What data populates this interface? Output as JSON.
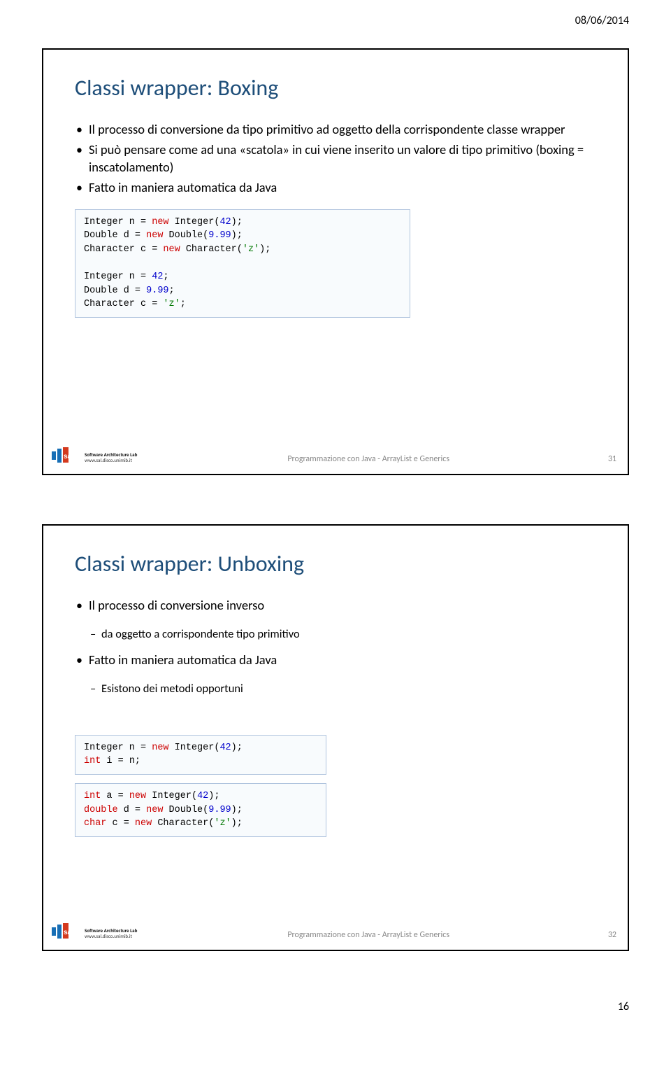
{
  "page": {
    "date": "08/06/2014",
    "number": "16"
  },
  "slide1": {
    "title": "Classi wrapper: Boxing",
    "b1": "Il processo di conversione da tipo primitivo ad oggetto della corrispondente classe wrapper",
    "b2": "Si può pensare come ad una «scatola» in cui viene inserito un valore di tipo primitivo (boxing = inscatolamento)",
    "b3": "Fatto in maniera automatica da Java",
    "footer_center": "Programmazione con Java - ArrayList e Generics",
    "footer_right": "31"
  },
  "slide2": {
    "title": "Classi wrapper: Unboxing",
    "b1": "Il processo di conversione inverso",
    "b1s1": "da oggetto a corrispondente tipo primitivo",
    "b2": "Fatto in maniera automatica da Java",
    "b2s1": "Esistono dei metodi opportuni",
    "footer_center": "Programmazione con Java - ArrayList e Generics",
    "footer_right": "32"
  },
  "logo": {
    "line1": "Software Architecture Lab",
    "line2": "www.sal.disco.unimib.it"
  },
  "code1": {
    "l1a": "Integer n = ",
    "l1b": "new",
    "l1c": " Integer(",
    "l1d": "42",
    "l1e": ");",
    "l2a": "Double d = ",
    "l2b": "new",
    "l2c": " Double(",
    "l2d": "9.99",
    "l2e": ");",
    "l3a": "Character c = ",
    "l3b": "new",
    "l3c": " Character(",
    "l3d": "'z'",
    "l3e": ");",
    "l4a": "Integer n = ",
    "l4b": "42",
    "l4c": ";",
    "l5a": "Double d = ",
    "l5b": "9.99",
    "l5c": ";",
    "l6a": "Character c = ",
    "l6b": "'z'",
    "l6c": ";"
  },
  "code2": {
    "l1a": "Integer n = ",
    "l1b": "new",
    "l1c": " Integer(",
    "l1d": "42",
    "l1e": ");",
    "l2a": "int",
    "l2b": " i = n;"
  },
  "code3": {
    "l1a": "int",
    "l1b": " a = ",
    "l1c": "new",
    "l1d": " Integer(",
    "l1e": "42",
    "l1f": ");",
    "l2a": "double",
    "l2b": " d = ",
    "l2c": "new",
    "l2d": " Double(",
    "l2e": "9.99",
    "l2f": ");",
    "l3a": "char",
    "l3b": " c = ",
    "l3c": "new",
    "l3d": " Character(",
    "l3e": "'z'",
    "l3f": ");"
  }
}
